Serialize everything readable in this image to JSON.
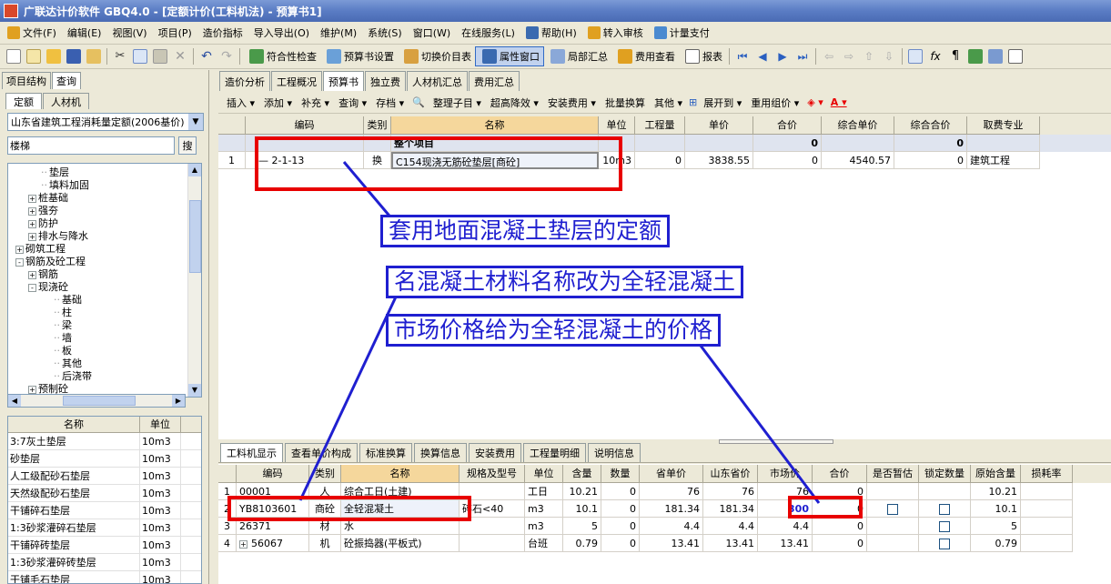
{
  "window": {
    "title": "广联达计价软件 GBQ4.0 - [定额计价(工料机法) - 预算书1]"
  },
  "menu": [
    {
      "label": "文件(F)",
      "icon": "file-icon"
    },
    {
      "label": "编辑(E)"
    },
    {
      "label": "视图(V)"
    },
    {
      "label": "项目(P)"
    },
    {
      "label": "造价指标"
    },
    {
      "label": "导入导出(O)"
    },
    {
      "label": "维护(M)"
    },
    {
      "label": "系统(S)"
    },
    {
      "label": "窗口(W)"
    },
    {
      "label": "在线服务(L)"
    },
    {
      "label": "帮助(H)",
      "icon": "help-icon"
    },
    {
      "label": "转入审核",
      "icon": "audit-icon"
    },
    {
      "label": "计量支付",
      "icon": "payment-icon"
    }
  ],
  "toolbar1": {
    "check": "符合性检查",
    "budget_settings": "预算书设置",
    "switch_view": "切换价目表",
    "property_window": "属性窗口",
    "local_summary": "局部汇总",
    "fee_view": "费用查看",
    "report": "报表"
  },
  "left": {
    "tabs": [
      "项目结构",
      "查询"
    ],
    "subtabs": [
      "定额",
      "人材机"
    ],
    "quota_select": "山东省建筑工程消耗量定额(2006基价)",
    "search_value": "楼梯",
    "search_button": "搜",
    "tree": [
      {
        "label": "垫层",
        "indent": 3,
        "exp": ""
      },
      {
        "label": "填料加固",
        "indent": 3,
        "exp": ""
      },
      {
        "label": "桩基础",
        "indent": 2,
        "exp": "+"
      },
      {
        "label": "强夯",
        "indent": 2,
        "exp": "+"
      },
      {
        "label": "防护",
        "indent": 2,
        "exp": "+"
      },
      {
        "label": "排水与降水",
        "indent": 2,
        "exp": "+"
      },
      {
        "label": "砌筑工程",
        "indent": 1,
        "exp": "+"
      },
      {
        "label": "钢筋及砼工程",
        "indent": 1,
        "exp": "-"
      },
      {
        "label": "钢筋",
        "indent": 2,
        "exp": "+"
      },
      {
        "label": "现浇砼",
        "indent": 2,
        "exp": "-"
      },
      {
        "label": "基础",
        "indent": 4,
        "exp": ""
      },
      {
        "label": "柱",
        "indent": 4,
        "exp": ""
      },
      {
        "label": "梁",
        "indent": 4,
        "exp": ""
      },
      {
        "label": "墙",
        "indent": 4,
        "exp": ""
      },
      {
        "label": "板",
        "indent": 4,
        "exp": ""
      },
      {
        "label": "其他",
        "indent": 4,
        "exp": ""
      },
      {
        "label": "后浇带",
        "indent": 4,
        "exp": ""
      },
      {
        "label": "预制砼",
        "indent": 2,
        "exp": "+"
      }
    ],
    "list_headers": [
      "名称",
      "单位"
    ],
    "list": [
      [
        "3:7灰土垫层",
        "10m3"
      ],
      [
        "砂垫层",
        "10m3"
      ],
      [
        "人工级配砂石垫层",
        "10m3"
      ],
      [
        "天然级配砂石垫层",
        "10m3"
      ],
      [
        "干铺碎石垫层",
        "10m3"
      ],
      [
        "1:3砂浆灌碎石垫层",
        "10m3"
      ],
      [
        "干铺碎砖垫层",
        "10m3"
      ],
      [
        "1:3砂浆灌碎砖垫层",
        "10m3"
      ],
      [
        "干铺毛石垫层",
        "10m3"
      ]
    ]
  },
  "main_tabs": [
    "造价分析",
    "工程概况",
    "预算书",
    "独立费",
    "人材机汇总",
    "费用汇总"
  ],
  "toolbar2": [
    "插入 ▾",
    "添加 ▾",
    "补充 ▾",
    "查询 ▾",
    "存档 ▾",
    "整理子目 ▾",
    "超高降效 ▾",
    "安装费用 ▾",
    "批量换算",
    "其他 ▾",
    "展开到 ▾",
    "重用组价 ▾"
  ],
  "upper_grid": {
    "headers": [
      "",
      "编码",
      "类别",
      "名称",
      "单位",
      "工程量",
      "单价",
      "合价",
      "综合单价",
      "综合合价",
      "取费专业"
    ],
    "rows": [
      [
        "",
        "",
        "",
        "整个项目",
        "",
        "",
        "",
        "0",
        "",
        "0",
        ""
      ],
      [
        "1",
        "— 2-1-13",
        "换",
        "C154现浇无筋砼垫层[商砼]",
        "10m3",
        "0",
        "3838.55",
        "0",
        "4540.57",
        "0",
        "建筑工程"
      ]
    ]
  },
  "bottom_tabs": [
    "工料机显示",
    "查看单价构成",
    "标准换算",
    "换算信息",
    "安装费用",
    "工程量明细",
    "说明信息"
  ],
  "lower_grid": {
    "headers": [
      "",
      "编码",
      "类别",
      "名称",
      "规格及型号",
      "单位",
      "含量",
      "数量",
      "省单价",
      "山东省价",
      "市场价",
      "合价",
      "是否暂估",
      "锁定数量",
      "原始含量",
      "损耗率"
    ],
    "rows": [
      [
        "1",
        "00001",
        "人",
        "综合工日(土建)",
        "",
        "工日",
        "10.21",
        "0",
        "76",
        "76",
        "76",
        "0",
        "",
        "",
        "10.21",
        ""
      ],
      [
        "2",
        "YB8103601",
        "商砼",
        "全轻混凝土",
        "碎石<40",
        "m3",
        "10.1",
        "0",
        "181.34",
        "181.34",
        "300",
        "0",
        "chk",
        "chk",
        "10.1",
        ""
      ],
      [
        "3",
        "26371",
        "材",
        "水",
        "",
        "m3",
        "5",
        "0",
        "4.4",
        "4.4",
        "4.4",
        "0",
        "",
        "chk",
        "5",
        ""
      ],
      [
        "4",
        "56067",
        "机",
        "砼振捣器(平板式)",
        "",
        "台班",
        "0.79",
        "0",
        "13.41",
        "13.41",
        "13.41",
        "0",
        "",
        "chk",
        "0.79",
        ""
      ]
    ]
  },
  "annotations": {
    "callout1": "套用地面混凝土垫层的定额",
    "callout2": "名混凝土材料名称改为全轻混凝土",
    "callout3": "市场价格给为全轻混凝土的价格"
  },
  "colors": {
    "annotation_blue": "#1f1fd0",
    "annotation_red": "#e80000",
    "title_blue": "#5a7cc4"
  }
}
